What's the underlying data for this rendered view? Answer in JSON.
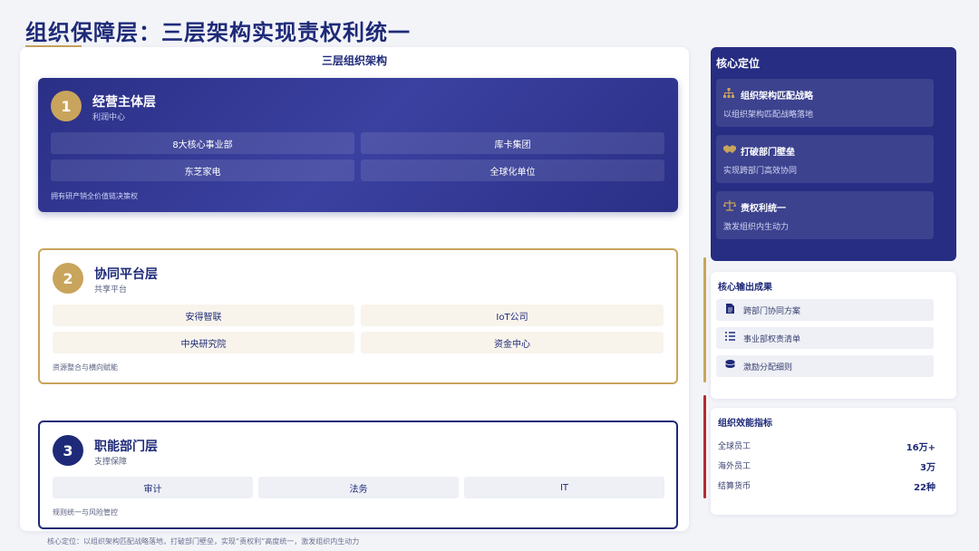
{
  "header": {
    "title": "组织保障层：三层架构实现责权利统一"
  },
  "structure": {
    "title": "三层组织架构",
    "layers": [
      {
        "number": "1",
        "name": "经营主体层",
        "subtitle": "利润中心",
        "units": [
          "8大核心事业部",
          "库卡集团",
          "东芝家电",
          "全球化单位"
        ],
        "note": "拥有研产销全价值链决策权"
      },
      {
        "number": "2",
        "name": "协同平台层",
        "subtitle": "共享平台",
        "units": [
          "安得智联",
          "IoT公司",
          "中央研究院",
          "资金中心"
        ],
        "note": "资源整合与横向赋能"
      },
      {
        "number": "3",
        "name": "职能部门层",
        "subtitle": "支撑保障",
        "units": [
          "审计",
          "法务",
          "IT"
        ],
        "note": "规则统一与风险管控"
      }
    ]
  },
  "footer": {
    "note": "核心定位：以组织架构匹配战略落地，打破部门壁垒，实现“责权利”高度统一，激发组织内生动力"
  },
  "positioning": {
    "title": "核心定位",
    "items": [
      {
        "icon": "org-chart-icon",
        "title": "组织架构匹配战略",
        "desc": "以组织架构匹配战略落地"
      },
      {
        "icon": "handshake-icon",
        "title": "打破部门壁垒",
        "desc": "实现跨部门高效协同"
      },
      {
        "icon": "balance-scale-icon",
        "title": "责权利统一",
        "desc": "激发组织内生动力"
      }
    ]
  },
  "outputs": {
    "title": "核心输出成果",
    "items": [
      {
        "icon": "document-icon",
        "label": "跨部门协同方案"
      },
      {
        "icon": "checklist-icon",
        "label": "事业部权责清单"
      },
      {
        "icon": "coins-icon",
        "label": "激励分配细则"
      }
    ]
  },
  "metrics": {
    "title": "组织效能指标",
    "rows": [
      {
        "label": "全球员工",
        "value": "16万+"
      },
      {
        "label": "海外员工",
        "value": "3万"
      },
      {
        "label": "结算货币",
        "value": "22种"
      }
    ]
  },
  "colors": {
    "navy": "#1e2a78",
    "gold": "#c9a45c",
    "red": "#b22b34"
  }
}
